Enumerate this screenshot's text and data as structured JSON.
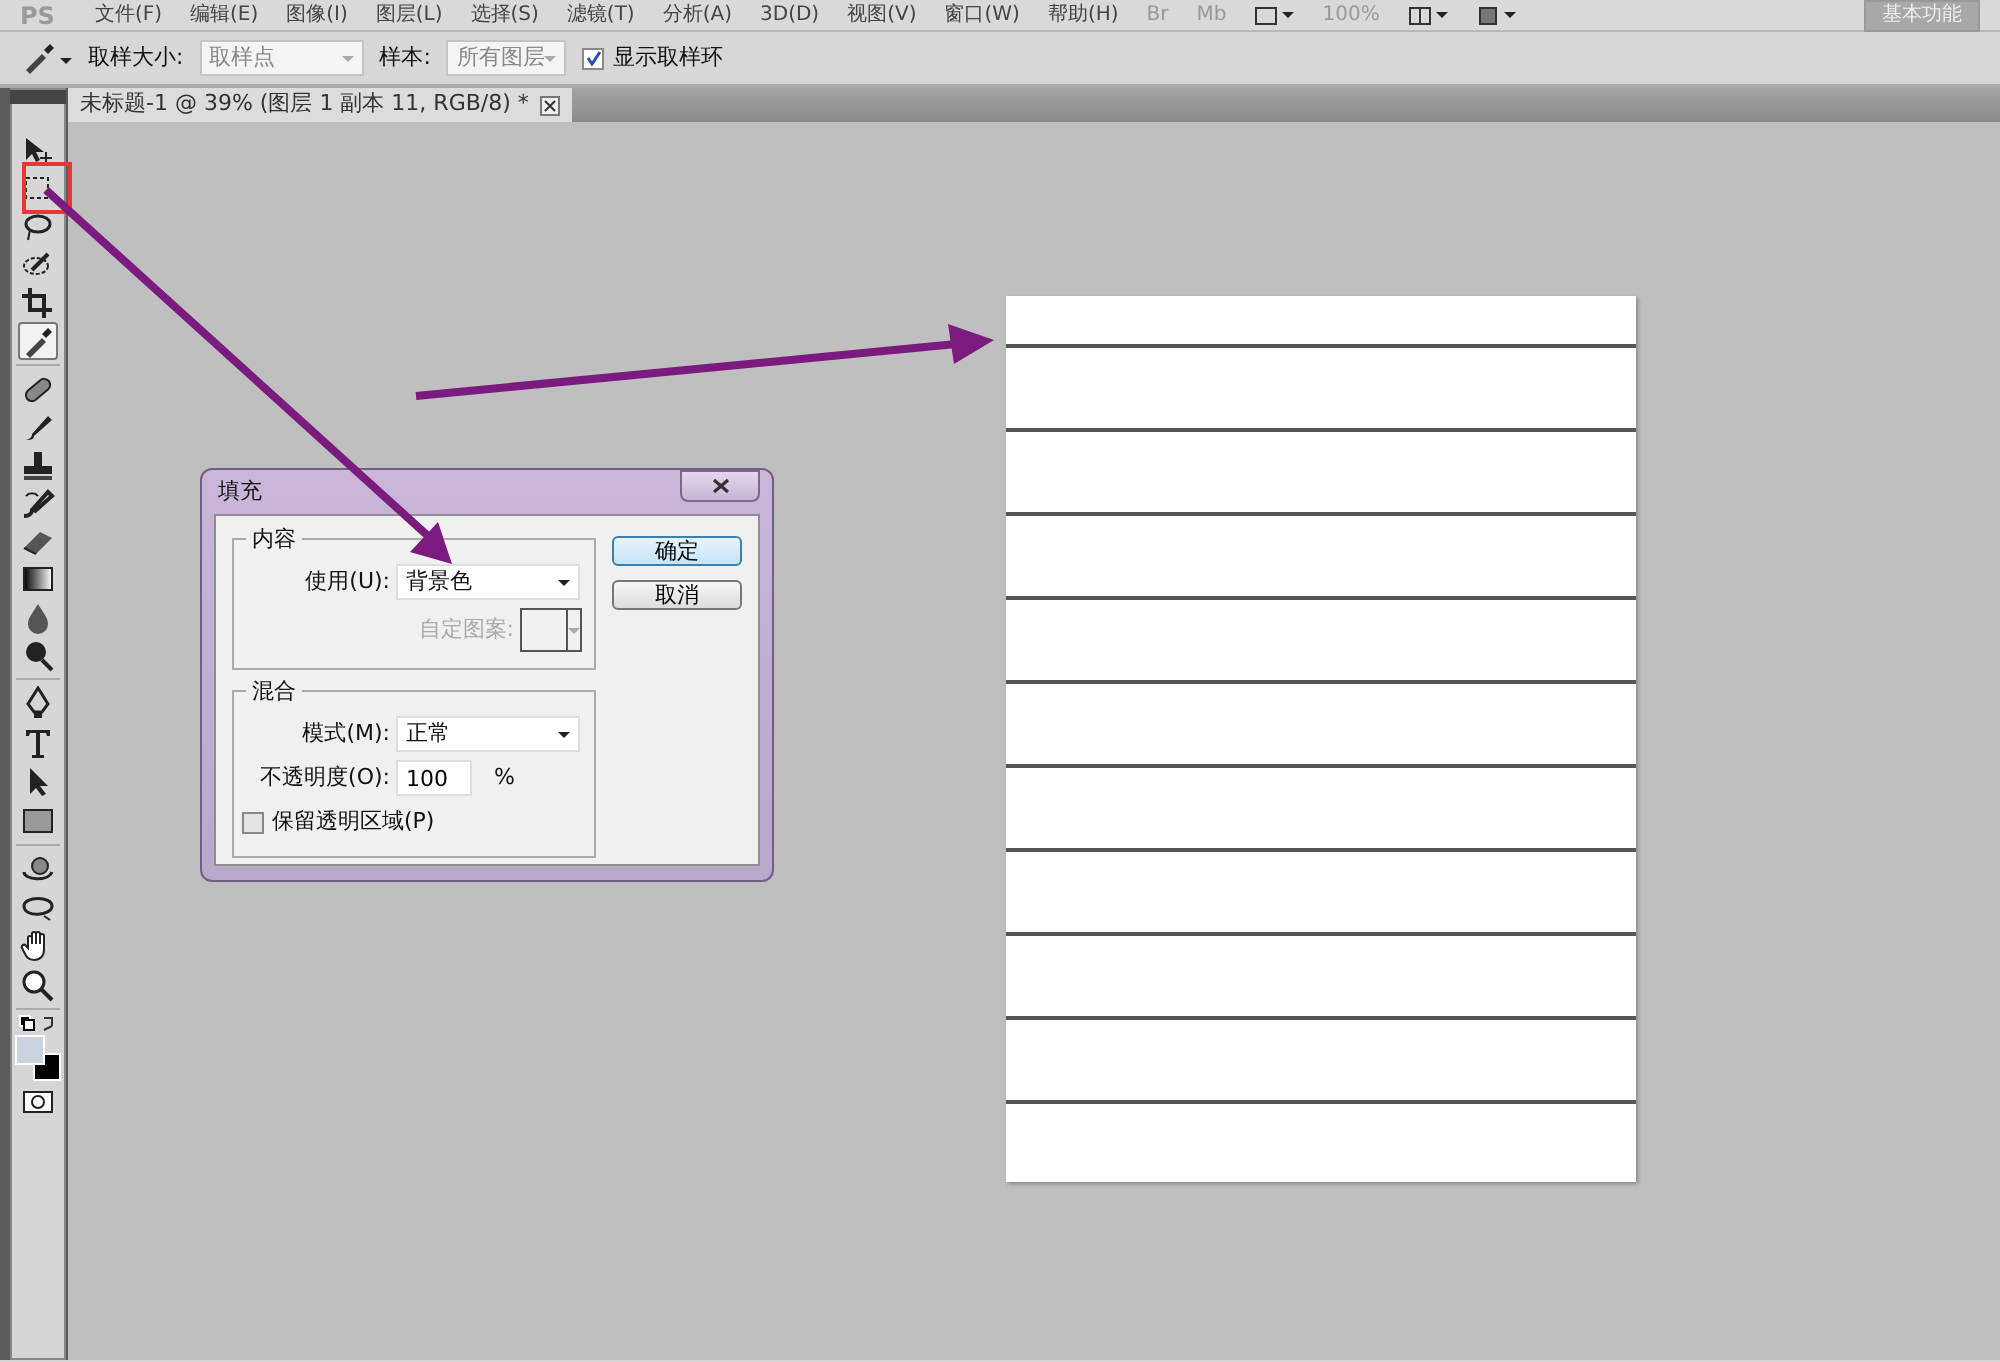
{
  "app_logo": "PS",
  "menu": [
    "文件(F)",
    "编辑(E)",
    "图像(I)",
    "图层(L)",
    "选择(S)",
    "滤镜(T)",
    "分析(A)",
    "3D(D)",
    "视图(V)",
    "窗口(W)",
    "帮助(H)"
  ],
  "app_bar": {
    "bridge": "Br",
    "mini_bridge": "Mb",
    "zoom": "100%",
    "workspace": "基本功能"
  },
  "options_bar": {
    "sample_size_label": "取样大小:",
    "sample_size": "取样点",
    "sample_label": "样本:",
    "sample": "所有图层",
    "show_ring": {
      "label": "显示取样环",
      "checked": true
    }
  },
  "document_tab": {
    "title": "未标题-1 @ 39% (图层 1 副本 11, RGB/8) *",
    "selected": true
  },
  "tools": [
    {
      "kind": "move",
      "selected": false
    },
    {
      "kind": "marquee",
      "selected": false
    },
    {
      "kind": "lasso",
      "selected": false
    },
    {
      "kind": "quick-select",
      "selected": false
    },
    {
      "kind": "crop",
      "selected": false
    },
    {
      "kind": "eyedropper",
      "selected": true
    },
    {
      "kind": "healing",
      "selected": false
    },
    {
      "kind": "brush",
      "selected": false
    },
    {
      "kind": "stamp",
      "selected": false
    },
    {
      "kind": "history",
      "selected": false
    },
    {
      "kind": "eraser",
      "selected": false
    },
    {
      "kind": "gradient",
      "selected": false
    },
    {
      "kind": "blur",
      "selected": false
    },
    {
      "kind": "dodge",
      "selected": false
    },
    {
      "kind": "pen",
      "selected": false
    },
    {
      "kind": "type",
      "selected": false
    },
    {
      "kind": "path-select",
      "selected": false
    },
    {
      "kind": "shape",
      "selected": false
    },
    {
      "kind": "rotate-3d",
      "selected": false
    },
    {
      "kind": "orbit-3d",
      "selected": false
    },
    {
      "kind": "hand",
      "selected": false
    },
    {
      "kind": "zoom",
      "selected": false
    },
    {
      "kind": "colors"
    },
    {
      "kind": "quick-mask",
      "selected": false
    }
  ],
  "document": {
    "bands": [
      {
        "kind": "band"
      },
      {
        "kind": "band"
      },
      {
        "kind": "band"
      },
      {
        "kind": "band"
      },
      {
        "kind": "band"
      },
      {
        "kind": "band"
      },
      {
        "kind": "band"
      },
      {
        "kind": "band"
      },
      {
        "kind": "band"
      },
      {
        "kind": "band"
      },
      {
        "kind": "band"
      }
    ]
  },
  "dialog": {
    "title": "填充",
    "content_group": {
      "title": "内容",
      "use_label": "使用(U):",
      "use_value": "背景色",
      "pattern_label": "自定图案:",
      "pattern_disabled": true
    },
    "blend_group": {
      "title": "混合",
      "mode_label": "模式(M):",
      "mode_value": "正常",
      "opacity_label": "不透明度(O):",
      "opacity_value": "100",
      "opacity_unit": "%",
      "preserve": {
        "label": "保留透明区域(P)",
        "checked": false
      }
    },
    "buttons": [
      {
        "label": "确定",
        "default": true
      },
      {
        "label": "取消",
        "default": false
      }
    ]
  },
  "annotations": [
    {
      "kind": "highlight"
    },
    {
      "kind": "arrow"
    },
    {
      "kind": "arrow"
    }
  ]
}
